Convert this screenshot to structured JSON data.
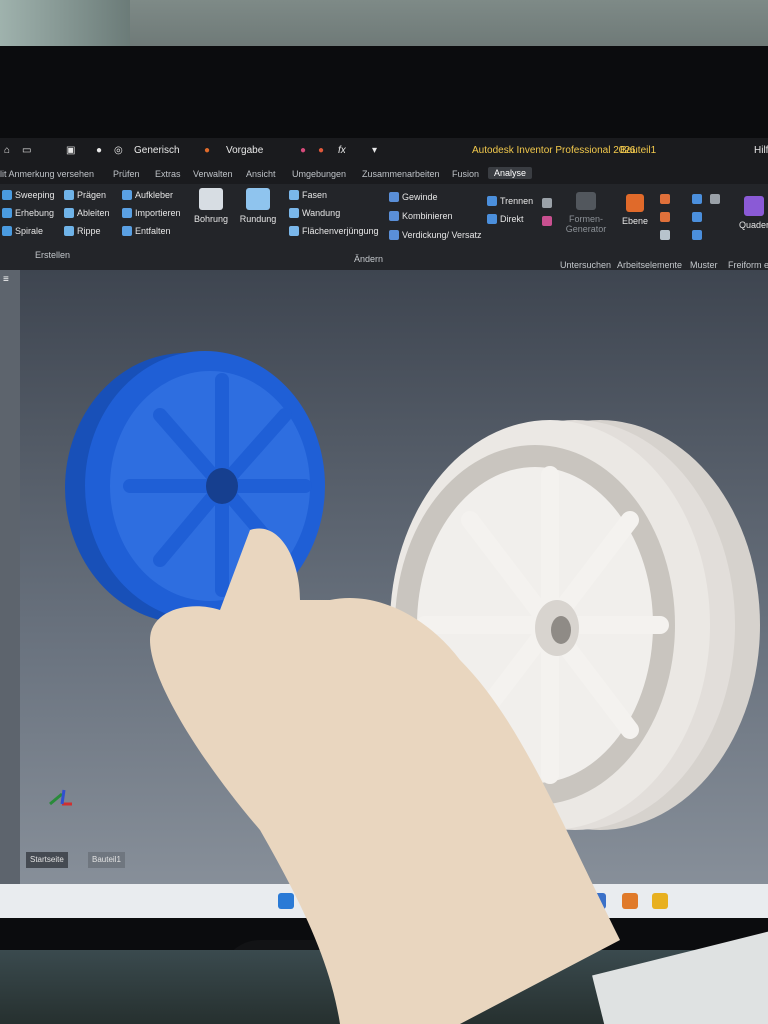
{
  "app": {
    "title": "Autodesk Inventor Professional 2026",
    "document": "Bauteil1",
    "help": "Hilf",
    "appearance_label": "Generisch",
    "appearance_default": "Vorgabe"
  },
  "tabs": [
    "lit Anmerkung versehen",
    "Prüfen",
    "Extras",
    "Verwalten",
    "Ansicht",
    "Umgebungen",
    "Zusammenarbeiten",
    "Fusion",
    "Analyse"
  ],
  "ribbon": {
    "create": [
      "Sweeping",
      "Erhebung",
      "Spirale"
    ],
    "create2": [
      "Prägen",
      "Ableiten",
      "Rippe"
    ],
    "create3": [
      "Aufkleber",
      "Importieren",
      "Entfalten"
    ],
    "big": [
      "Bohrung",
      "Rundung"
    ],
    "modify1": [
      "Fasen",
      "Wandung",
      "Flächenverjüngung"
    ],
    "modify2": [
      "Gewinde",
      "Kombinieren",
      "Verdickung/ Versatz"
    ],
    "modify3": [
      "Trennen",
      "Direkt"
    ],
    "generator": "Formen-\nGenerator",
    "plane": "Ebene",
    "freeform": "Quader",
    "groups": {
      "create": "Erstellen",
      "modify": "Ändern",
      "explore": "Untersuchen",
      "work": "Arbeitselemente",
      "pattern": "Muster",
      "freeform": "Freiform e"
    }
  },
  "doc_tabs": [
    "Startseite",
    "Bauteil1"
  ],
  "colors": {
    "printed_part": "#1f5fd6",
    "cad_model": "#ebe8e4",
    "accent": "#3a8bd6"
  }
}
